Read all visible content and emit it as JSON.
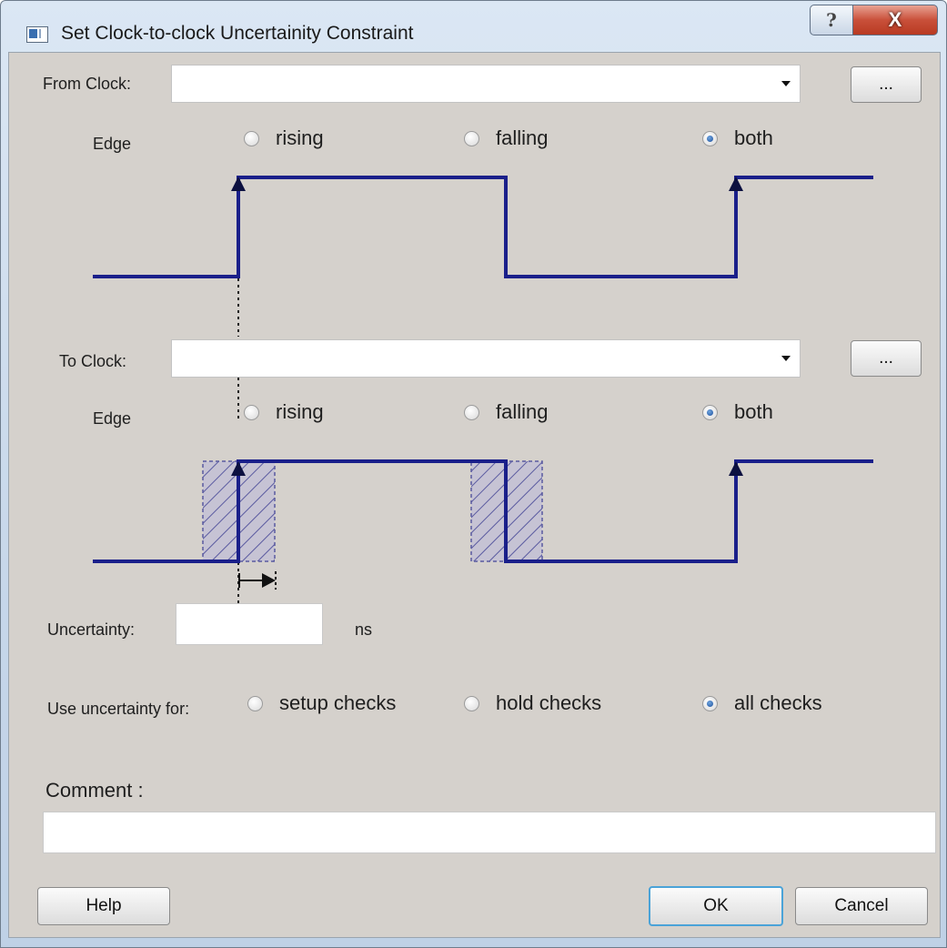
{
  "window": {
    "title": "Set Clock-to-clock Uncertainity Constraint",
    "help_glyph": "?",
    "close_glyph": "X"
  },
  "from_clock": {
    "label": "From Clock:",
    "value": "",
    "browse_label": "...",
    "edge_label": "Edge",
    "edge_options": [
      "rising",
      "falling",
      "both"
    ],
    "edge_selected": "both"
  },
  "to_clock": {
    "label": "To Clock:",
    "value": "",
    "browse_label": "...",
    "edge_label": "Edge",
    "edge_options": [
      "rising",
      "falling",
      "both"
    ],
    "edge_selected": "both"
  },
  "uncertainty": {
    "label": "Uncertainty:",
    "value": "",
    "unit": "ns"
  },
  "use_for": {
    "label": "Use uncertainty for:",
    "options": [
      "setup checks",
      "hold checks",
      "all checks"
    ],
    "selected": "all checks"
  },
  "comment": {
    "label": "Comment :",
    "value": ""
  },
  "buttons": {
    "help": "Help",
    "ok": "OK",
    "cancel": "Cancel"
  },
  "colors": {
    "waveform": "#1a1f8a",
    "client_bg": "#d5d1cc",
    "hatch": "#5a5aa0"
  },
  "icons": {
    "app": "window-app-icon",
    "help": "question-icon",
    "close": "close-icon",
    "combo": "dropdown-arrow-icon"
  }
}
